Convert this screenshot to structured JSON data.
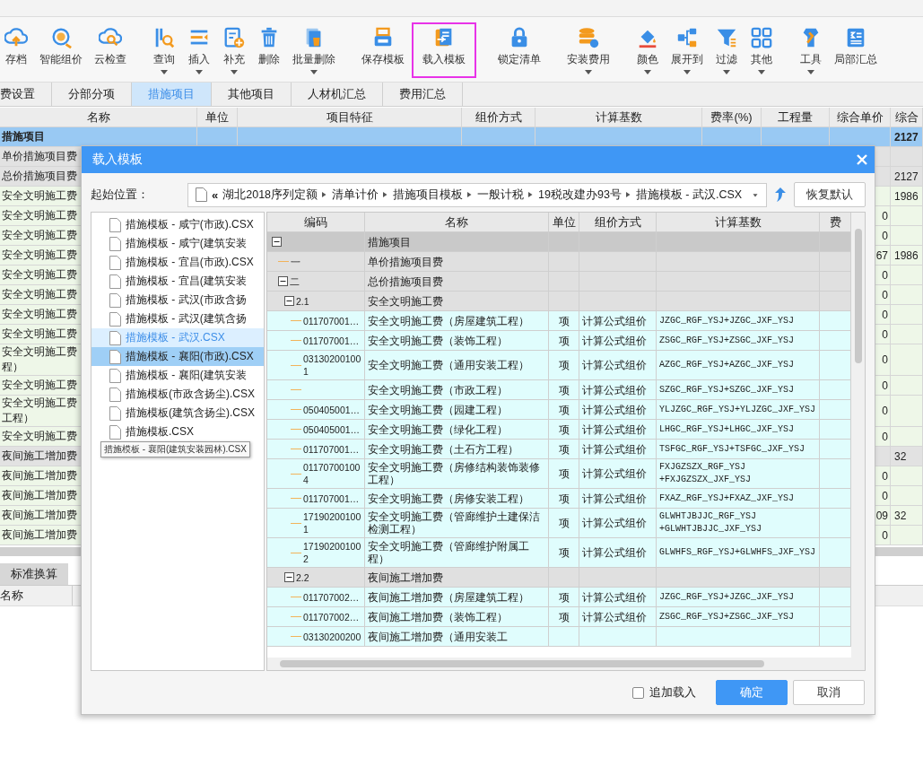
{
  "toolbar": [
    {
      "label": "存档",
      "dropdown": false,
      "highlighted": false
    },
    {
      "label": "智能组价",
      "dropdown": false,
      "highlighted": false
    },
    {
      "label": "云检查",
      "dropdown": false,
      "highlighted": false
    },
    {
      "label": "查询",
      "dropdown": true,
      "highlighted": false
    },
    {
      "label": "插入",
      "dropdown": true,
      "highlighted": false
    },
    {
      "label": "补充",
      "dropdown": true,
      "highlighted": false
    },
    {
      "label": "删除",
      "dropdown": false,
      "highlighted": false
    },
    {
      "label": "批量删除",
      "dropdown": true,
      "highlighted": false
    },
    {
      "label": "保存模板",
      "dropdown": false,
      "highlighted": false
    },
    {
      "label": "载入模板",
      "dropdown": false,
      "highlighted": true
    },
    {
      "label": "锁定清单",
      "dropdown": false,
      "highlighted": false
    },
    {
      "label": "安装费用",
      "dropdown": true,
      "highlighted": false
    },
    {
      "label": "颜色",
      "dropdown": true,
      "highlighted": false
    },
    {
      "label": "展开到",
      "dropdown": true,
      "highlighted": false
    },
    {
      "label": "过滤",
      "dropdown": true,
      "highlighted": false
    },
    {
      "label": "其他",
      "dropdown": true,
      "highlighted": false
    },
    {
      "label": "工具",
      "dropdown": true,
      "highlighted": false
    },
    {
      "label": "局部汇总",
      "dropdown": false,
      "highlighted": false
    }
  ],
  "tabs": [
    {
      "label": "费设置",
      "selected": false
    },
    {
      "label": "分部分项",
      "selected": false
    },
    {
      "label": "措施项目",
      "selected": true
    },
    {
      "label": "其他项目",
      "selected": false
    },
    {
      "label": "人材机汇总",
      "selected": false
    },
    {
      "label": "费用汇总",
      "selected": false
    }
  ],
  "grid": {
    "columns": [
      "名称",
      "单位",
      "项目特征",
      "组价方式",
      "计算基数",
      "费率(%)",
      "工程量",
      "综合单价",
      "综合"
    ],
    "rows": [
      {
        "kind": "summary",
        "name": [
          "措施项目"
        ],
        "total": "2127"
      },
      {
        "kind": "group",
        "name": [
          "单价措施项目费"
        ]
      },
      {
        "kind": "group",
        "name": [
          "总价措施项目费"
        ],
        "total": "2127"
      },
      {
        "kind": "item",
        "name": [
          "安全文明施工费"
        ],
        "total": "1986"
      },
      {
        "kind": "item",
        "name": [
          "安全文明施工费"
        ],
        "price": "0"
      },
      {
        "kind": "item",
        "name": [
          "安全文明施工费"
        ],
        "price": "0"
      },
      {
        "kind": "item",
        "name": [
          "安全文明施工费"
        ],
        "price": "67",
        "total": "1986"
      },
      {
        "kind": "item",
        "name": [
          "安全文明施工费"
        ],
        "price": "0"
      },
      {
        "kind": "item",
        "name": [
          "安全文明施工费"
        ],
        "price": "0"
      },
      {
        "kind": "item",
        "name": [
          "安全文明施工费"
        ],
        "price": "0"
      },
      {
        "kind": "item",
        "name": [
          "安全文明施工费"
        ],
        "price": "0"
      },
      {
        "kind": "item",
        "name": [
          "安全文明施工费",
          "程）"
        ],
        "price": "0"
      },
      {
        "kind": "item",
        "name": [
          "安全文明施工费"
        ],
        "price": "0"
      },
      {
        "kind": "item",
        "name": [
          "安全文明施工费",
          "工程）"
        ],
        "price": "0"
      },
      {
        "kind": "item",
        "name": [
          "安全文明施工费"
        ],
        "price": "0"
      },
      {
        "kind": "group",
        "name": [
          "夜间施工增加费"
        ],
        "total": "32"
      },
      {
        "kind": "item",
        "name": [
          "夜间施工增加费"
        ],
        "price": "0"
      },
      {
        "kind": "item",
        "name": [
          "夜间施工增加费"
        ],
        "price": "0"
      },
      {
        "kind": "item",
        "name": [
          "夜间施工增加费"
        ],
        "price": "09",
        "total": "32"
      },
      {
        "kind": "item",
        "name": [
          "夜间施工增加费"
        ],
        "price": "0"
      }
    ]
  },
  "bottom_panel": {
    "tabs": [
      {
        "label": "标准换算",
        "selected": false
      }
    ],
    "columns": [
      "名称"
    ]
  },
  "dialog": {
    "title": "载入模板",
    "location_label": "起始位置：",
    "path_prefix": "«",
    "path": [
      "湖北2018序列定额",
      "清单计价",
      "措施项目模板",
      "一般计税",
      "19税改建办93号",
      "措施模板 - 武汉.CSX"
    ],
    "restore_button": "恢复默认",
    "files": [
      {
        "label": "措施模板 - 咸宁(市政).CSX",
        "selected": false,
        "hovered": false
      },
      {
        "label": "措施模板 - 咸宁(建筑安装",
        "selected": false,
        "hovered": false
      },
      {
        "label": "措施模板 - 宜昌(市政).CSX",
        "selected": false,
        "hovered": false
      },
      {
        "label": "措施模板 - 宜昌(建筑安装",
        "selected": false,
        "hovered": false
      },
      {
        "label": "措施模板 - 武汉(市政含扬",
        "selected": false,
        "hovered": false
      },
      {
        "label": "措施模板 - 武汉(建筑含扬",
        "selected": false,
        "hovered": false
      },
      {
        "label": "措施模板 - 武汉.CSX",
        "selected": false,
        "hovered": true
      },
      {
        "label": "措施模板 - 襄阳(市政).CSX",
        "selected": true,
        "hovered": false
      },
      {
        "label": "措施模板 - 襄阳(建筑安装",
        "selected": false,
        "hovered": false
      },
      {
        "label": "措施模板(市政含扬尘).CSX",
        "selected": false,
        "hovered": false
      },
      {
        "label": "措施模板(建筑含扬尘).CSX",
        "selected": false,
        "hovered": false
      },
      {
        "label": "措施模板.CSX",
        "selected": false,
        "hovered": false
      }
    ],
    "tooltip": "措施模板 - 襄阳(建筑安装园林).CSX",
    "table": {
      "columns": [
        "编码",
        "名称",
        "单位",
        "组价方式",
        "计算基数",
        "费"
      ],
      "rows": [
        {
          "name": "措施项目",
          "expanded": true,
          "children": [
            {
              "code": "一",
              "name": "单价措施项目费"
            },
            {
              "code": "二",
              "name": "总价措施项目费",
              "expanded": true,
              "children": [
                {
                  "code": "2.1",
                  "name": "安全文明施工费",
                  "expanded": true,
                  "children": [
                    {
                      "code": "011707001…",
                      "name": "安全文明施工费（房屋建筑工程）",
                      "unit": "项",
                      "method": "计算公式组价",
                      "base": "JZGC_RGF_YSJ+JZGC_JXF_YSJ"
                    },
                    {
                      "code": "011707001…",
                      "name": "安全文明施工费（装饰工程）",
                      "unit": "项",
                      "method": "计算公式组价",
                      "base": "ZSGC_RGF_YSJ+ZSGC_JXF_YSJ"
                    },
                    {
                      "code": "031302001001",
                      "name": "安全文明施工费（通用安装工程）",
                      "unit": "项",
                      "method": "计算公式组价",
                      "base": "AZGC_RGF_YSJ+AZGC_JXF_YSJ"
                    },
                    {
                      "name": "安全文明施工费（市政工程）",
                      "unit": "项",
                      "method": "计算公式组价",
                      "base": "SZGC_RGF_YSJ+SZGC_JXF_YSJ"
                    },
                    {
                      "code": "050405001…",
                      "name": "安全文明施工费（园建工程）",
                      "unit": "项",
                      "method": "计算公式组价",
                      "base": "YLJZGC_RGF_YSJ+YLJZGC_JXF_YSJ"
                    },
                    {
                      "code": "050405001…",
                      "name": "安全文明施工费（绿化工程）",
                      "unit": "项",
                      "method": "计算公式组价",
                      "base": "LHGC_RGF_YSJ+LHGC_JXF_YSJ"
                    },
                    {
                      "code": "011707001…",
                      "name": "安全文明施工费（土石方工程）",
                      "unit": "项",
                      "method": "计算公式组价",
                      "base": "TSFGC_RGF_YSJ+TSFGC_JXF_YSJ"
                    },
                    {
                      "code": "011707001004",
                      "name": "安全文明施工费（房修结构装饰装修工程）",
                      "unit": "项",
                      "method": "计算公式组价",
                      "base": "FXJGZSZX_RGF_YSJ +FXJGZSZX_JXF_YSJ"
                    },
                    {
                      "code": "011707001…",
                      "name": "安全文明施工费（房修安装工程）",
                      "unit": "项",
                      "method": "计算公式组价",
                      "base": "FXAZ_RGF_YSJ+FXAZ_JXF_YSJ"
                    },
                    {
                      "code": "171902001001",
                      "name": "安全文明施工费（管廊维护土建保洁检测工程）",
                      "unit": "项",
                      "method": "计算公式组价",
                      "base": "GLWHTJBJJC_RGF_YSJ +GLWHTJBJJC_JXF_YSJ"
                    },
                    {
                      "code": "171902001002",
                      "name": "安全文明施工费（管廊维护附属工程）",
                      "unit": "项",
                      "method": "计算公式组价",
                      "base": "GLWHFS_RGF_YSJ+GLWHFS_JXF_YSJ"
                    }
                  ]
                },
                {
                  "code": "2.2",
                  "name": "夜间施工增加费",
                  "expanded": true,
                  "children": [
                    {
                      "code": "011707002…",
                      "name": "夜间施工增加费（房屋建筑工程）",
                      "unit": "项",
                      "method": "计算公式组价",
                      "base": "JZGC_RGF_YSJ+JZGC_JXF_YSJ"
                    },
                    {
                      "code": "011707002…",
                      "name": "夜间施工增加费（装饰工程）",
                      "unit": "项",
                      "method": "计算公式组价",
                      "base": "ZSGC_RGF_YSJ+ZSGC_JXF_YSJ"
                    },
                    {
                      "code": "03130200200",
                      "name": "夜间施工增加费（通用安装工"
                    }
                  ]
                }
              ]
            }
          ]
        }
      ]
    },
    "append": {
      "label": "追加载入",
      "checked": false
    },
    "ok_button": "确定",
    "cancel_button": "取消"
  }
}
